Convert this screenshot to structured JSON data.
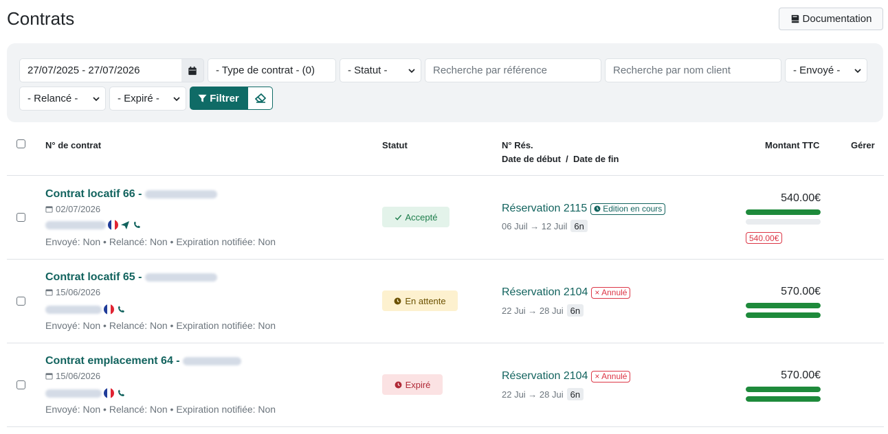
{
  "page": {
    "title": "Contrats",
    "doc_button": "Documentation"
  },
  "filters": {
    "date_range": "27/07/2025 - 27/07/2026",
    "contract_type": "- Type de contrat - (0)",
    "status": "- Statut -",
    "search_ref_placeholder": "Recherche par référence",
    "search_client_placeholder": "Recherche par nom client",
    "sent": "- Envoyé -",
    "reminded": "- Relancé -",
    "expired": "- Expiré -",
    "filter_button": "Filtrer"
  },
  "table": {
    "headers": {
      "contract_no": "N° de contrat",
      "status": "Statut",
      "res_no": "N° Rés.",
      "dates": "Date de début  /  Date de fin",
      "amount": "Montant TTC",
      "manage": "Gérer"
    },
    "rows": [
      {
        "title": "Contrat locatif 66 -",
        "date": "02/07/2026",
        "meta": "Envoyé: Non • Relancé: Non • Expiration notifiée: Non",
        "status": "Accepté",
        "reservation": "Réservation 2115",
        "reservation_tag": "Edition en cours",
        "date_span": "06 Juil → 12 Juil",
        "nights": "6n",
        "amount": "540.00€",
        "paid_fraction": 1.0,
        "second_fraction": 0.0,
        "balance_tag": "540.00€"
      },
      {
        "title": "Contrat locatif 65 -",
        "date": "15/06/2026",
        "meta": "Envoyé: Non • Relancé: Non • Expiration notifiée: Non",
        "status": "En attente",
        "reservation": "Réservation 2104",
        "reservation_tag": "× Annulé",
        "date_span": "22 Jui → 28 Jui",
        "nights": "6n",
        "amount": "570.00€",
        "paid_fraction": 1.0,
        "second_fraction": 1.0
      },
      {
        "title": "Contrat emplacement 64 -",
        "date": "15/06/2026",
        "meta": "Envoyé: Non • Relancé: Non • Expiration notifiée: Non",
        "status": "Expiré",
        "reservation": "Réservation 2104",
        "reservation_tag": "× Annulé",
        "date_span": "22 Jui → 28 Jui",
        "nights": "6n",
        "amount": "570.00€",
        "paid_fraction": 1.0,
        "second_fraction": 1.0
      }
    ]
  },
  "colors": {
    "accent": "#0f6b66",
    "link": "#12635e",
    "bar_green": "#1e8a3b",
    "danger": "#dc3545"
  }
}
